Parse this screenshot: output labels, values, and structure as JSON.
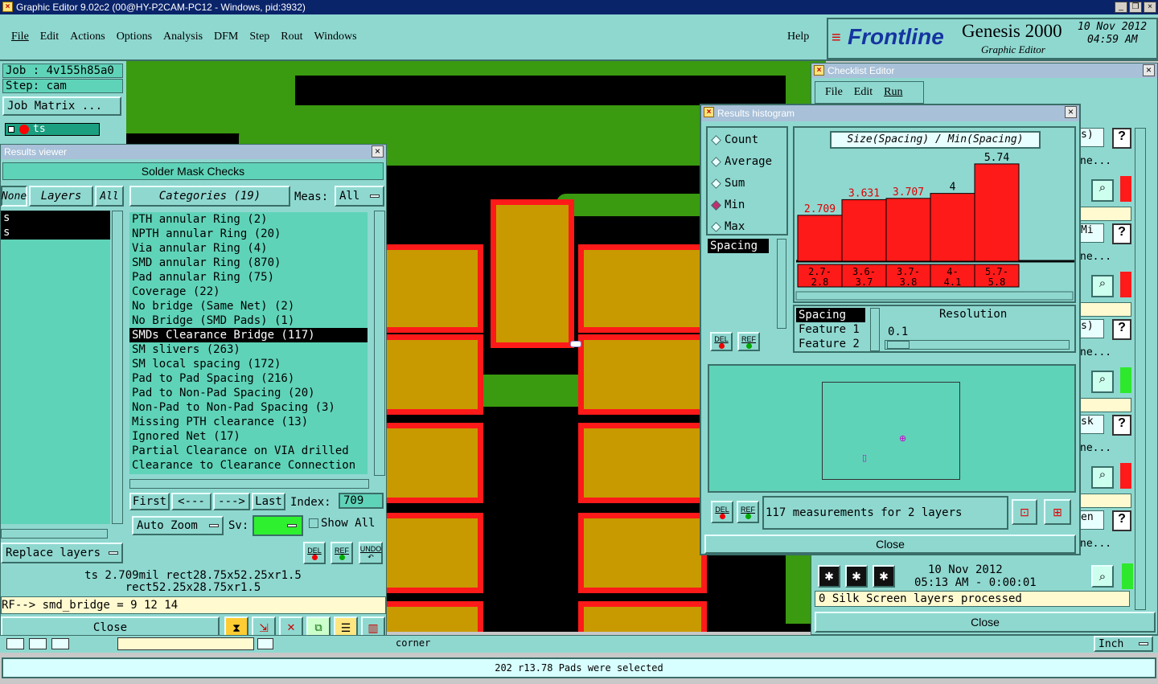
{
  "os_title": "Graphic Editor 9.02c2 (00@HY-P2CAM-PC12 - Windows, pid:3932)",
  "menu": [
    "File",
    "Edit",
    "Actions",
    "Options",
    "Analysis",
    "DFM",
    "Step",
    "Rout",
    "Windows"
  ],
  "help_label": "Help",
  "brand": {
    "logo": "Frontline",
    "product": "Genesis 2000",
    "subtitle": "Graphic Editor",
    "date": "10 Nov 2012",
    "time": "04:59 AM"
  },
  "job_panel": {
    "job": "Job : 4v155h85a0",
    "step": "Step: cam",
    "job_matrix": "Job Matrix ...",
    "layer": "ts"
  },
  "results_viewer": {
    "title": "Results viewer",
    "header": "Solder Mask Checks",
    "tabs": [
      "None",
      "Layers",
      "All"
    ],
    "categories_label": "Categories (19)",
    "meas_label": "Meas:",
    "meas_value": "All",
    "left_items": [
      "s",
      "s"
    ],
    "categories": [
      "PTH annular Ring (2)",
      "NPTH annular Ring (20)",
      "Via annular Ring (4)",
      "SMD annular Ring (870)",
      "Pad annular Ring (75)",
      "Coverage (22)",
      "No bridge (Same Net) (2)",
      "No Bridge (SMD Pads) (1)",
      "SMDs Clearance Bridge (117)",
      "SM slivers (263)",
      "SM local spacing (172)",
      "Pad to Pad Spacing (216)",
      "Pad to Non-Pad Spacing (20)",
      "Non-Pad to Non-Pad Spacing (3)",
      "Missing PTH clearance (13)",
      "Ignored Net (17)",
      "Partial Clearance on VIA drilled",
      "Clearance to Clearance Connection"
    ],
    "selected_index": 8,
    "nav": [
      "First",
      "<---",
      "--->",
      "Last"
    ],
    "index_label": "Index:",
    "index_value": "709",
    "auto_zoom": "Auto Zoom",
    "sv_label": "Sv:",
    "show_all": "Show All",
    "replace_layers": "Replace layers",
    "del": "DEL",
    "ref": "REF",
    "undo": "UNDO",
    "info_line1": "ts 2.709mil  rect28.75x52.25xr1.5",
    "info_line2": "rect52.25x28.75xr1.5",
    "formula": "RF--> smd_bridge = 9 12 14",
    "close": "Close"
  },
  "histogram": {
    "title": "Results histogram",
    "modes": [
      "Count",
      "Average",
      "Sum",
      "Min",
      "Max"
    ],
    "selected_mode": "Min",
    "chart_title": "Size(Spacing) / Min(Spacing)",
    "chart_data": {
      "type": "bar",
      "categories": [
        "2.7-2.8",
        "3.6-3.7",
        "3.7-3.8",
        "4-4.1",
        "5.7-5.8"
      ],
      "values": [
        2.709,
        3.631,
        3.707,
        4,
        5.74
      ],
      "value_labels": [
        "2.709",
        "3.631",
        "3.707",
        "4",
        "5.74"
      ],
      "bin_labels_top": [
        "2.7-",
        "3.6-",
        "3.7-",
        "4-",
        "5.7-"
      ],
      "bin_labels_bottom": [
        "2.8",
        "3.7",
        "3.8",
        "4.1",
        "5.8"
      ],
      "ylim": [
        0,
        6.4
      ]
    },
    "attr_list": [
      "Spacing"
    ],
    "attr_list2": [
      "Spacing",
      "Feature 1",
      "Feature 2"
    ],
    "resolution_label": "Resolution",
    "resolution_value": "0.1",
    "measurements": "117 measurements for 2 layers",
    "close": "Close",
    "del": "DEL",
    "ref": "REF"
  },
  "checklist": {
    "title": "Checklist Editor",
    "menu": [
      "File",
      "Edit",
      "Run"
    ],
    "partial_labels": [
      "s)",
      "ne...",
      "Mi",
      "ne...",
      "s)",
      "ne...",
      "sk",
      "ne...",
      "en",
      "ne..."
    ],
    "date": "10 Nov 2012",
    "time": "05:13 AM - 0:00:01",
    "status": "0 Silk Screen layers processed",
    "close": "Close"
  },
  "bottom": {
    "coord_text": "corner",
    "unit": "Inch",
    "status": "202 r13.78 Pads were selected"
  },
  "colors": {
    "board_green": "#3a9a10",
    "pad_gold": "#c89a00",
    "mask_red": "#ff1a1a",
    "panel": "#8fd8d0",
    "field": "#5fd3b8",
    "bar_red": "#ff1a1a",
    "title_blue": "#4070a8"
  }
}
